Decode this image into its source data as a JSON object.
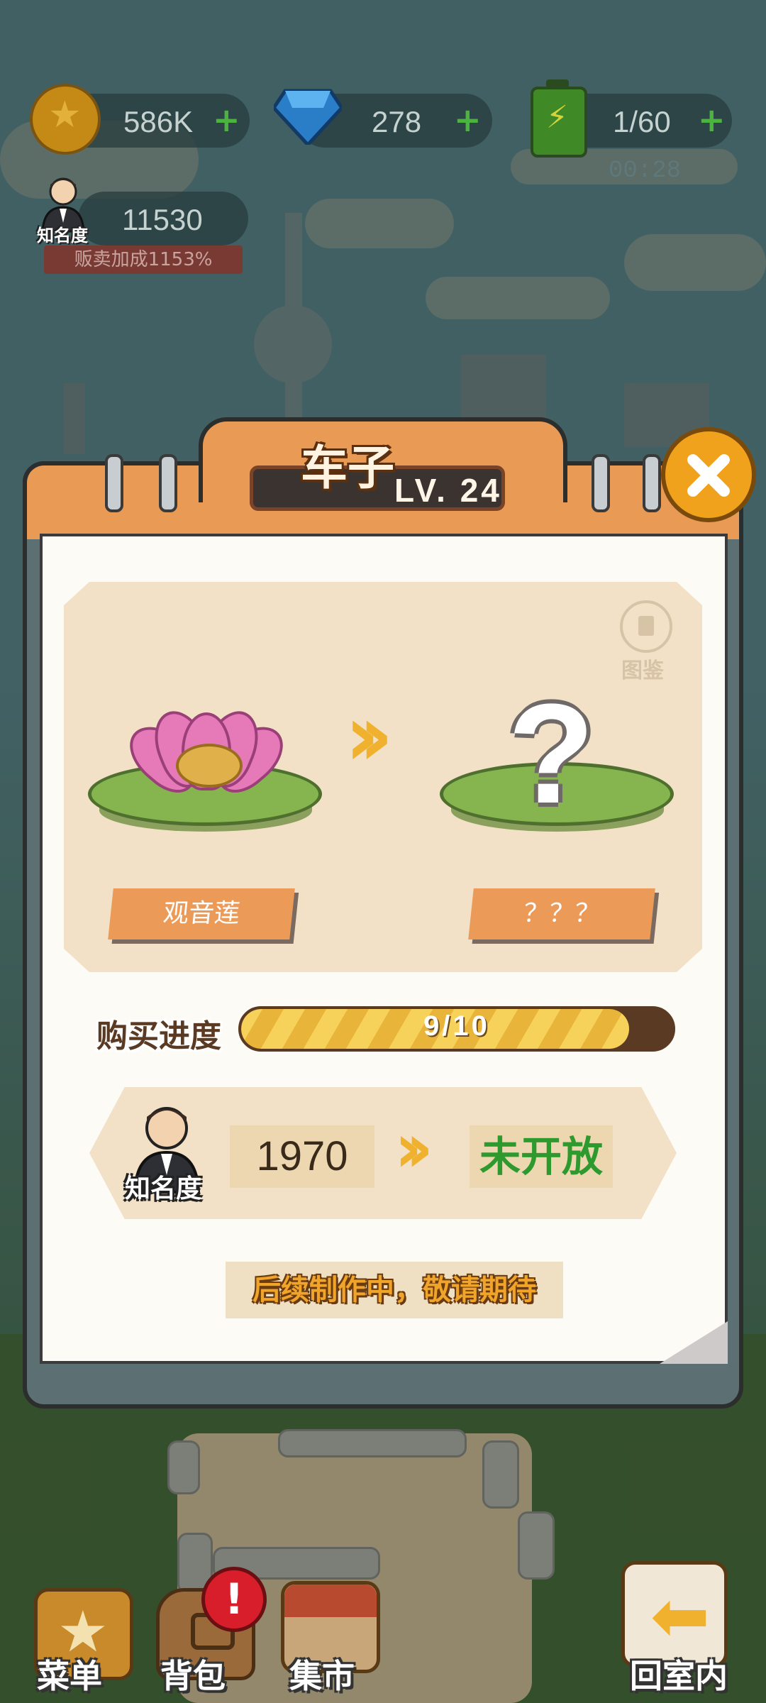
{
  "hud": {
    "coins": "586K",
    "gems": "278",
    "energy": "1/60",
    "energy_timer": "00:28",
    "fame_icon_label": "知名度",
    "fame_value": "11530",
    "sales_bonus": "贩卖加成1153%"
  },
  "panel": {
    "title": "车子",
    "level": "LV. 24",
    "encyclopedia_label": "图鉴",
    "current_item": "观音莲",
    "next_item": "？？？",
    "progress_label": "购买进度",
    "progress_text": "9/10",
    "progress": {
      "current": 9,
      "total": 10
    },
    "fame_label": "知名度",
    "fame_required": "1970",
    "status": "未开放",
    "coming_soon": "后续制作中，敬请期待"
  },
  "nav": {
    "menu": "菜单",
    "backpack": "背包",
    "backpack_badge": "!",
    "market": "集市",
    "home": "回室内"
  },
  "icons": {
    "close": "close-icon",
    "encyclopedia": "book-icon",
    "arrow": "double-chevron-right-icon"
  },
  "colors": {
    "panel_orange": "#e99a54",
    "progress_yellow": "#f7d25a",
    "status_green": "#2e9a2e",
    "close_button": "#f0a21c"
  }
}
